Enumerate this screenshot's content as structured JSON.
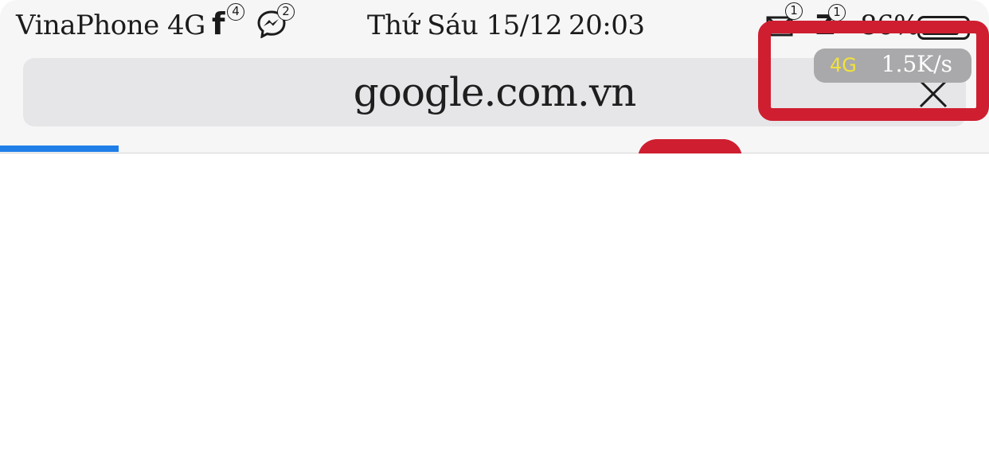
{
  "status_bar": {
    "carrier": "VinaPhone",
    "network": "4G",
    "facebook_badge": "4",
    "messenger_badge": "2",
    "day_date": "Thứ Sáu 15/12",
    "time": "20:03",
    "mail_badge": "1",
    "zalo_badge": "1",
    "battery_text": "86%",
    "battery_level": 0.86
  },
  "browser": {
    "url": "google.com.vn",
    "load_progress": 0.12
  },
  "speed_overlay": {
    "network": "4G",
    "speed": "1.5K/s"
  },
  "colors": {
    "highlight": "#cf1e30",
    "progress": "#1f7ee8",
    "network_label": "#f2e23a"
  }
}
